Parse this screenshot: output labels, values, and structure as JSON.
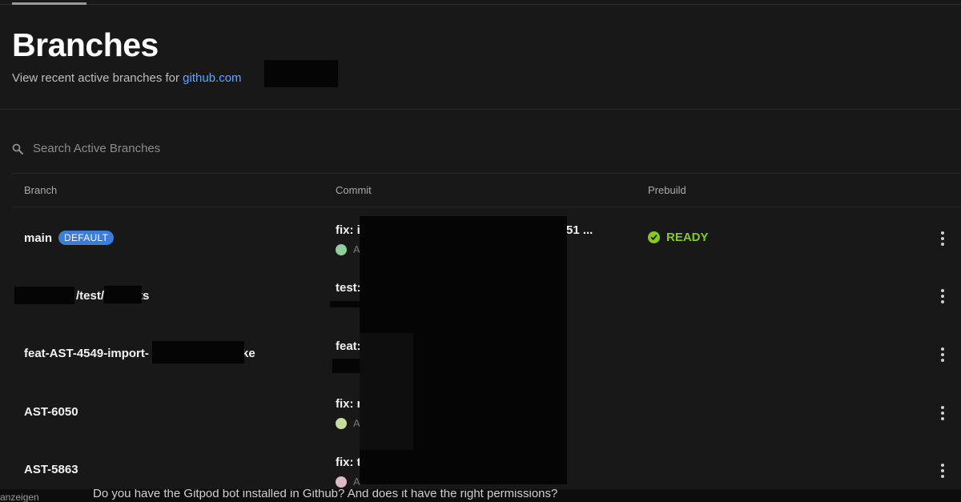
{
  "header": {
    "title": "Branches",
    "subtitle_prefix": "View recent active branches for",
    "repo_link": "github.com"
  },
  "search": {
    "placeholder": "Search Active Branches"
  },
  "table": {
    "columns": [
      "Branch",
      "Commit",
      "Prebuild"
    ],
    "rows": [
      {
        "branch": "main",
        "badge": "DEFAULT",
        "commit": "fix: i",
        "commit_tail": "51 ...",
        "author_initial": "A",
        "prebuild": "READY"
      },
      {
        "branch_visible_a": "/test/",
        "branch_visible_b": "ts",
        "commit": "test:",
        "author_initial": "",
        "prebuild": ""
      },
      {
        "branch_prefix": "feat-AST-4549-import-",
        "branch_suffix": "ke",
        "commit": "feat:",
        "author_initial": "",
        "prebuild": ""
      },
      {
        "branch": "AST-6050",
        "commit": "fix: r",
        "author_initial": "A",
        "prebuild": ""
      },
      {
        "branch": "AST-5863",
        "commit": "fix: t",
        "author_initial": "A",
        "prebuild": ""
      }
    ]
  },
  "footer": {
    "left_text": "anzeigen",
    "overlay_text": "Do you have the Gitpod bot installed in Github? And does it have the right permissions?"
  },
  "colors": {
    "accent": "#58a6ff",
    "badge": "#3b7dd8",
    "ready": "#84cc16",
    "background": "#181818"
  }
}
